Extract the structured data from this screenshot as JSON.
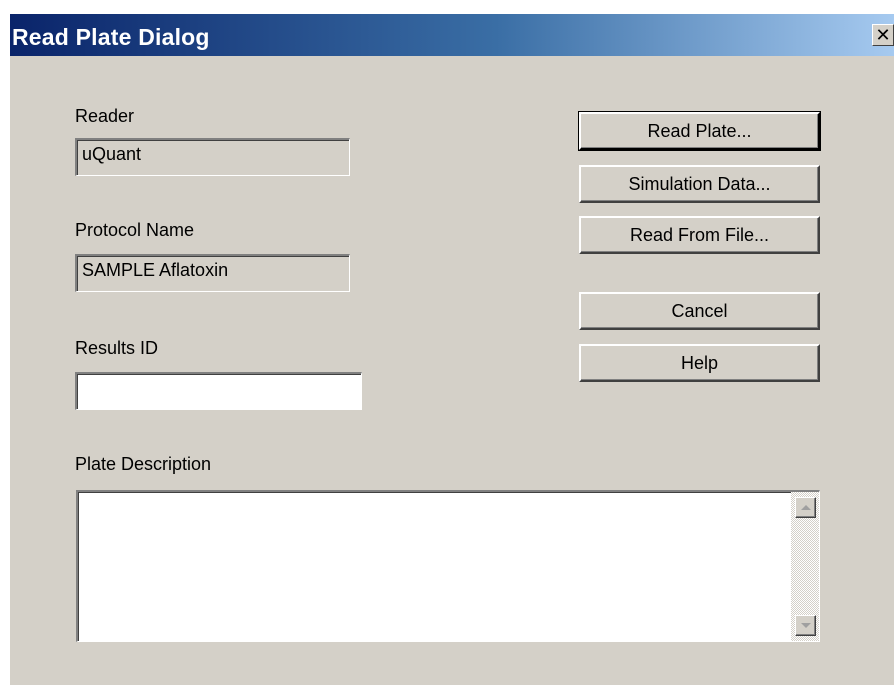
{
  "window": {
    "title": "Read Plate Dialog",
    "close_glyph": "✕"
  },
  "reader": {
    "label": "Reader",
    "value": "uQuant"
  },
  "protocol": {
    "label": "Protocol Name",
    "value": "SAMPLE Aflatoxin"
  },
  "results": {
    "label": "Results ID",
    "value": ""
  },
  "description": {
    "label": "Plate Description",
    "value": ""
  },
  "buttons": {
    "read_plate": "Read Plate...",
    "simulation_data": "Simulation Data...",
    "read_from_file": "Read From File...",
    "cancel": "Cancel",
    "help": "Help"
  },
  "icons": {
    "close": "close-icon",
    "scroll_up": "scroll-up-arrow-icon",
    "scroll_down": "scroll-down-arrow-icon"
  },
  "colors": {
    "titlebar_start": "#0a246a",
    "titlebar_end": "#a6caf0",
    "dialog_face": "#d4d0c8"
  }
}
